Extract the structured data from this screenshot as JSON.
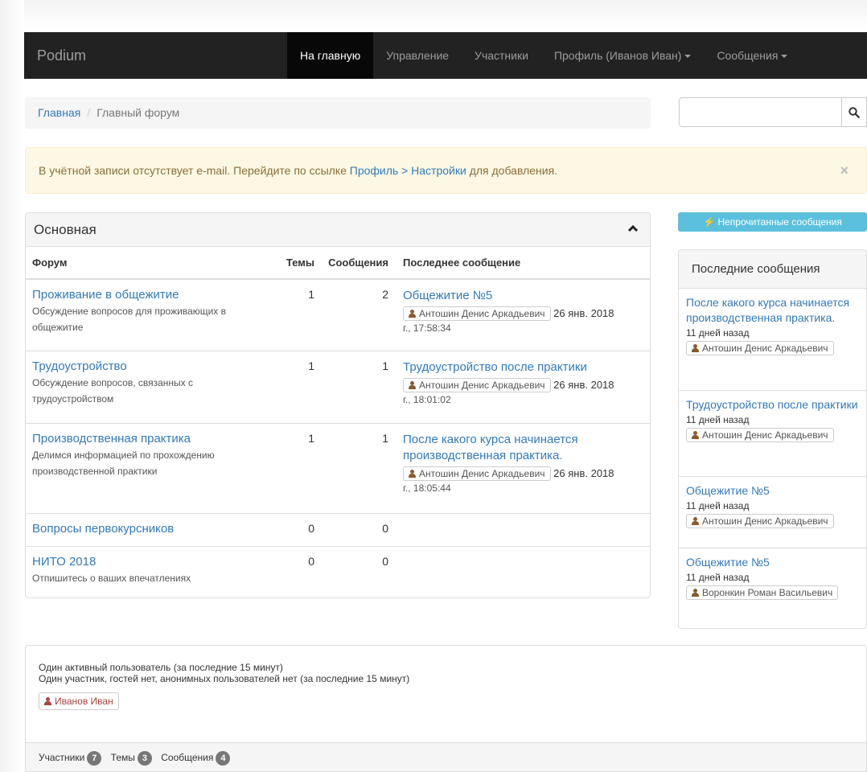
{
  "navbar": {
    "brand": "Podium",
    "items": [
      {
        "label": "На главную"
      },
      {
        "label": "Управление"
      },
      {
        "label": "Участники"
      },
      {
        "label": "Профиль (Иванов Иван)"
      },
      {
        "label": "Сообщения"
      }
    ]
  },
  "breadcrumb": {
    "home": "Главная",
    "separator": "/",
    "current": "Главный форум"
  },
  "search": {
    "placeholder": ""
  },
  "alert": {
    "text_before": "В учётной записи отсутствует e-mail. Перейдите по ссылке ",
    "link": "Профиль > Настройки",
    "text_after": " для добавления.",
    "close": "×"
  },
  "forum_panel": {
    "title": "Основная",
    "columns": {
      "forum": "Форум",
      "topics": "Темы",
      "messages": "Сообщения",
      "last": "Последнее сообщение"
    },
    "rows": [
      {
        "title": "Проживание в общежитие",
        "desc": "Обсуждение вопросов для проживающих в общежитие",
        "topics": "1",
        "messages": "2",
        "last_title": "Общежитие №5",
        "last_user": "Антошин Денис Аркадьевич",
        "last_date": "26 янв. 2018",
        "last_time": "г., 17:58:34"
      },
      {
        "title": "Трудоустройство",
        "desc": "Обсуждение вопросов, связанных с трудоустройством",
        "topics": "1",
        "messages": "1",
        "last_title": "Трудоустройство после практики",
        "last_user": "Антошин Денис Аркадьевич",
        "last_date": "26 янв. 2018",
        "last_time": "г., 18:01:02"
      },
      {
        "title": "Производственная практика",
        "desc": "Делимся информацией по прохождению производственной практики",
        "topics": "1",
        "messages": "1",
        "last_title": "После какого курса начинается производственная практика.",
        "last_user": "Антошин Денис Аркадьевич",
        "last_date": "26 янв. 2018",
        "last_time": "г., 18:05:44"
      },
      {
        "title": "Вопросы первокурсников",
        "desc": "",
        "topics": "0",
        "messages": "0"
      },
      {
        "title": "НИТО 2018",
        "desc": "Отпишитесь о ваших впечатлениях",
        "topics": "0",
        "messages": "0"
      }
    ]
  },
  "unread_button": "Непрочитанные сообщения",
  "recent": {
    "title": "Последние сообщения",
    "items": [
      {
        "title": "После какого курса начинается производственная практика.",
        "ago": "11 дней назад",
        "user": "Антошин Денис Аркадьевич"
      },
      {
        "title": "Трудоустройство после практики",
        "ago": "11 дней назад",
        "user": "Антошин Денис Аркадьевич"
      },
      {
        "title": "Общежитие №5",
        "ago": "11 дней назад",
        "user": "Антошин Денис Аркадьевич"
      },
      {
        "title": "Общежитие №5",
        "ago": "11 дней назад",
        "user": "Воронкин Роман Васильевич"
      }
    ]
  },
  "stats": {
    "line1": "Один активный пользователь (за последние 15 минут)",
    "line2": "Один участник, гостей нет, анонимных пользователей нет (за последние 15 минут)",
    "user": "Иванов Иван",
    "footer": [
      {
        "label": "Участники",
        "count": "7"
      },
      {
        "label": "Темы",
        "count": "3"
      },
      {
        "label": "Сообщения",
        "count": "4"
      }
    ]
  },
  "colors": {
    "navbar": "#222222",
    "link": "#337ab7",
    "alert_bg": "#fcf8e3",
    "info": "#5bc0de",
    "user_red": "#a94442"
  }
}
